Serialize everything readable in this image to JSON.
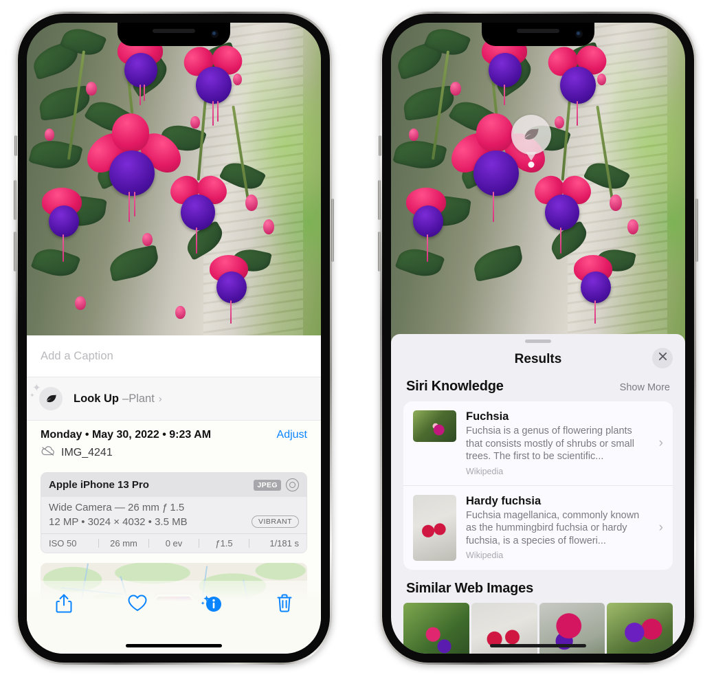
{
  "left_phone": {
    "name": "iphone-photos-info",
    "caption_placeholder": "Add a Caption",
    "lookup": {
      "icon": "leaf-icon",
      "label": "Look Up",
      "dash": " – ",
      "subject": "Plant",
      "chevron": "›"
    },
    "metadata": {
      "date": "Monday • May 30, 2022 • 9:23 AM",
      "adjust_label": "Adjust",
      "cloud_icon": "icloud-slash-icon",
      "filename": "IMG_4241"
    },
    "exif": {
      "device": "Apple iPhone 13 Pro",
      "format_tag": "JPEG",
      "raw_icon": "aperture-icon",
      "lens_line": "Wide Camera — 26 mm ƒ 1.5",
      "size_line": "12 MP • 3024 × 4032 • 3.5 MB",
      "style_tag": "VIBRANT",
      "stats": [
        "ISO 50",
        "26 mm",
        "0 ev",
        "ƒ1.5",
        "1/181 s"
      ]
    },
    "map": {
      "name": "location-map",
      "pin": "photo-thumbnail-pin"
    },
    "toolbar": [
      {
        "name": "share-button",
        "icon": "share-icon"
      },
      {
        "name": "favorite-button",
        "icon": "heart-icon"
      },
      {
        "name": "info-button",
        "icon": "info-sparkle-icon"
      },
      {
        "name": "delete-button",
        "icon": "trash-icon"
      }
    ]
  },
  "right_phone": {
    "name": "iphone-visual-lookup-results",
    "badge": {
      "name": "visual-lookup-leaf-badge",
      "icon": "leaf-icon"
    },
    "panel": {
      "grabber": "sheet-grabber",
      "title": "Results",
      "close_icon": "close-icon"
    },
    "siri_knowledge": {
      "heading": "Siri Knowledge",
      "show_more": "Show More",
      "entries": [
        {
          "title": "Fuchsia",
          "description": "Fuchsia is a genus of flowering plants that consists mostly of shrubs or small trees. The first to be scientific...",
          "source": "Wikipedia",
          "chevron": "›"
        },
        {
          "title": "Hardy fuchsia",
          "description": "Fuchsia magellanica, commonly known as the hummingbird fuchsia or hardy fuchsia, is a species of floweri...",
          "source": "Wikipedia",
          "chevron": "›"
        }
      ]
    },
    "similar_web_images": {
      "heading": "Similar Web Images",
      "thumbnails": [
        "fuchsia-web-image-1",
        "fuchsia-web-image-2",
        "fuchsia-web-image-3",
        "fuchsia-web-image-4"
      ]
    }
  },
  "colors": {
    "ios_blue": "#0A84FF",
    "panel_bg": "#F0EFF4",
    "card_bg": "#FBFAFF",
    "sheet_bg": "#FDFDFA"
  }
}
